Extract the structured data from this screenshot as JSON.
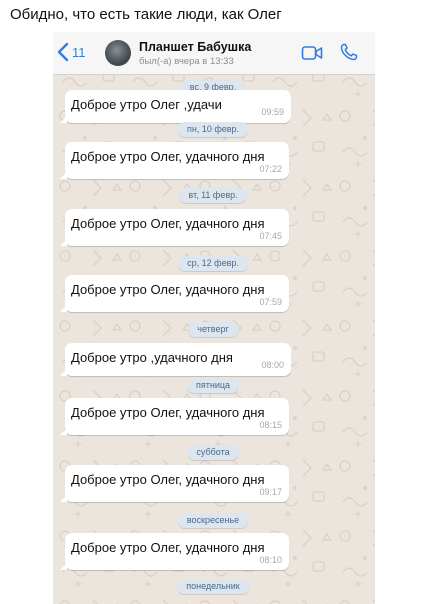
{
  "caption": "Обидно, что есть такие люди, как Олег",
  "header": {
    "back_count": "11",
    "contact_name": "Планшет Бабушка",
    "last_seen": "был(-а) вчера в 13:33"
  },
  "colors": {
    "chat_background": "#ece5dd",
    "header_background": "#f6f6f6",
    "accent": "#2f7de1",
    "bubble": "#ffffff",
    "date_pill": "#dde6ef"
  },
  "chat": {
    "dates": [
      "вс, 9 февр.",
      "пн, 10 февр.",
      "вт, 11 февр.",
      "ср, 12 февр.",
      "четверг",
      "пятница",
      "суббота",
      "воскресенье",
      "понедельник"
    ],
    "messages": [
      {
        "text": "Доброе утро Олег ,удачи",
        "time": "09:59"
      },
      {
        "text": "Доброе утро Олег, удачного дня",
        "time": "07:22"
      },
      {
        "text": "Доброе утро Олег, удачного дня",
        "time": "07:45"
      },
      {
        "text": "Доброе утро Олег, удачного дня",
        "time": "07:59"
      },
      {
        "text": "Доброе утро ,удачного  дня",
        "time": "08:00"
      },
      {
        "text": "Доброе утро Олег, удачного дня",
        "time": "08:15"
      },
      {
        "text": "Доброе утро Олег, удачного дня",
        "time": "09:17"
      },
      {
        "text": "Доброе утро Олег, удачного дня",
        "time": "08:10"
      }
    ]
  }
}
